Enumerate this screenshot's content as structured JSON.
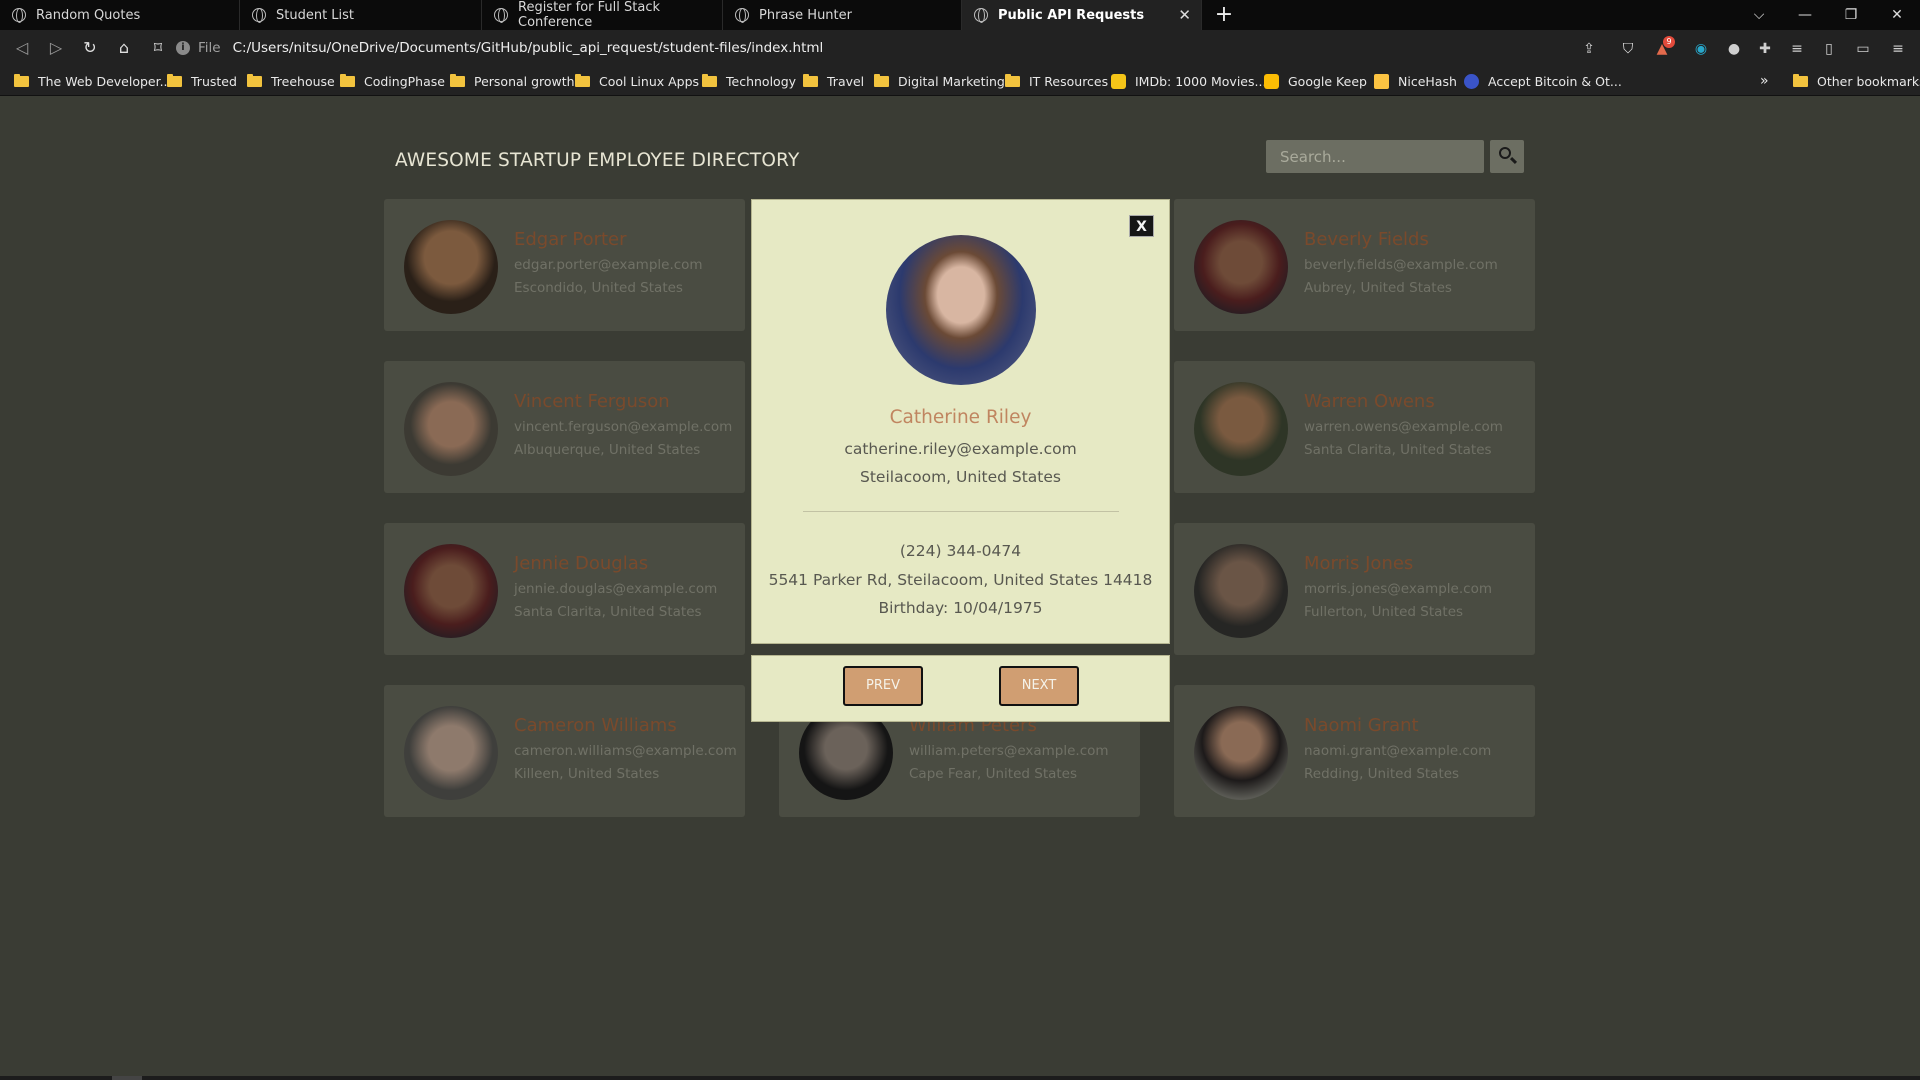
{
  "browser": {
    "tabs": [
      {
        "label": "Random Quotes",
        "active": false
      },
      {
        "label": "Student List",
        "active": false
      },
      {
        "label": "Register for Full Stack Conference",
        "active": false
      },
      {
        "label": "Phrase Hunter",
        "active": false
      },
      {
        "label": "Public API Requests",
        "active": true
      }
    ],
    "tab_close": "✕",
    "new_tab": "+",
    "url_scheme": "File",
    "url": "C:/Users/nitsu/OneDrive/Documents/GitHub/public_api_request/student-files/index.html",
    "window_controls": {
      "dropdown": "⌵",
      "minimize": "—",
      "restore": "❐",
      "close": "✕"
    },
    "notification_count": "9",
    "bookmarks": [
      {
        "label": "The Web Developer...",
        "icon": "folder-icon"
      },
      {
        "label": "Trusted",
        "icon": "folder-icon"
      },
      {
        "label": "Treehouse",
        "icon": "folder-icon"
      },
      {
        "label": "CodingPhase",
        "icon": "folder-icon"
      },
      {
        "label": "Personal growth",
        "icon": "folder-icon"
      },
      {
        "label": "Cool Linux Apps",
        "icon": "folder-icon"
      },
      {
        "label": "Technology",
        "icon": "folder-icon"
      },
      {
        "label": "Travel",
        "icon": "folder-icon"
      },
      {
        "label": "Digital Marketing",
        "icon": "folder-icon"
      },
      {
        "label": "IT Resources",
        "icon": "folder-icon"
      },
      {
        "label": "IMDb: 1000 Movies...",
        "icon": "imdb-icon"
      },
      {
        "label": "Google Keep",
        "icon": "keep-icon"
      },
      {
        "label": "NiceHash",
        "icon": "nicehash-icon"
      },
      {
        "label": "Accept Bitcoin & Ot...",
        "icon": "bitcoin-icon"
      }
    ],
    "bookmarks_overflow": "»",
    "other_bookmarks": "Other bookmarks"
  },
  "page": {
    "title": "AWESOME STARTUP EMPLOYEE DIRECTORY",
    "search_placeholder": "Search..."
  },
  "employees": [
    {
      "name": "Edgar Porter",
      "email": "edgar.porter@example.com",
      "location": "Escondido, United States"
    },
    {
      "name": "Beverly Fields",
      "email": "beverly.fields@example.com",
      "location": "Aubrey, United States"
    },
    {
      "name": "Vincent Ferguson",
      "email": "vincent.ferguson@example.com",
      "location": "Albuquerque, United States"
    },
    {
      "name": "Warren Owens",
      "email": "warren.owens@example.com",
      "location": "Santa Clarita, United States"
    },
    {
      "name": "Jennie Douglas",
      "email": "jennie.douglas@example.com",
      "location": "Santa Clarita, United States"
    },
    {
      "name": "Morris Jones",
      "email": "morris.jones@example.com",
      "location": "Fullerton, United States"
    },
    {
      "name": "Cameron Williams",
      "email": "cameron.williams@example.com",
      "location": "Killeen, United States"
    },
    {
      "name": "William Peters",
      "email": "william.peters@example.com",
      "location": "Cape Fear, United States"
    },
    {
      "name": "Naomi Grant",
      "email": "naomi.grant@example.com",
      "location": "Redding, United States"
    }
  ],
  "modal": {
    "close_label": "X",
    "name": "Catherine Riley",
    "email": "catherine.riley@example.com",
    "city": "Steilacoom, United States",
    "phone": "(224) 344-0474",
    "address": "5541 Parker Rd, Steilacoom, United States 14418",
    "birthday": "Birthday: 10/04/1975",
    "prev_label": "PREV",
    "next_label": "NEXT"
  },
  "colors": {
    "page_bg": "#3a3c34",
    "card_bg": "#4a4c42",
    "card_name": "#7a4a2c",
    "modal_bg": "#e6e9c4",
    "modal_name": "#c08560",
    "button_bg": "#d09e72"
  }
}
